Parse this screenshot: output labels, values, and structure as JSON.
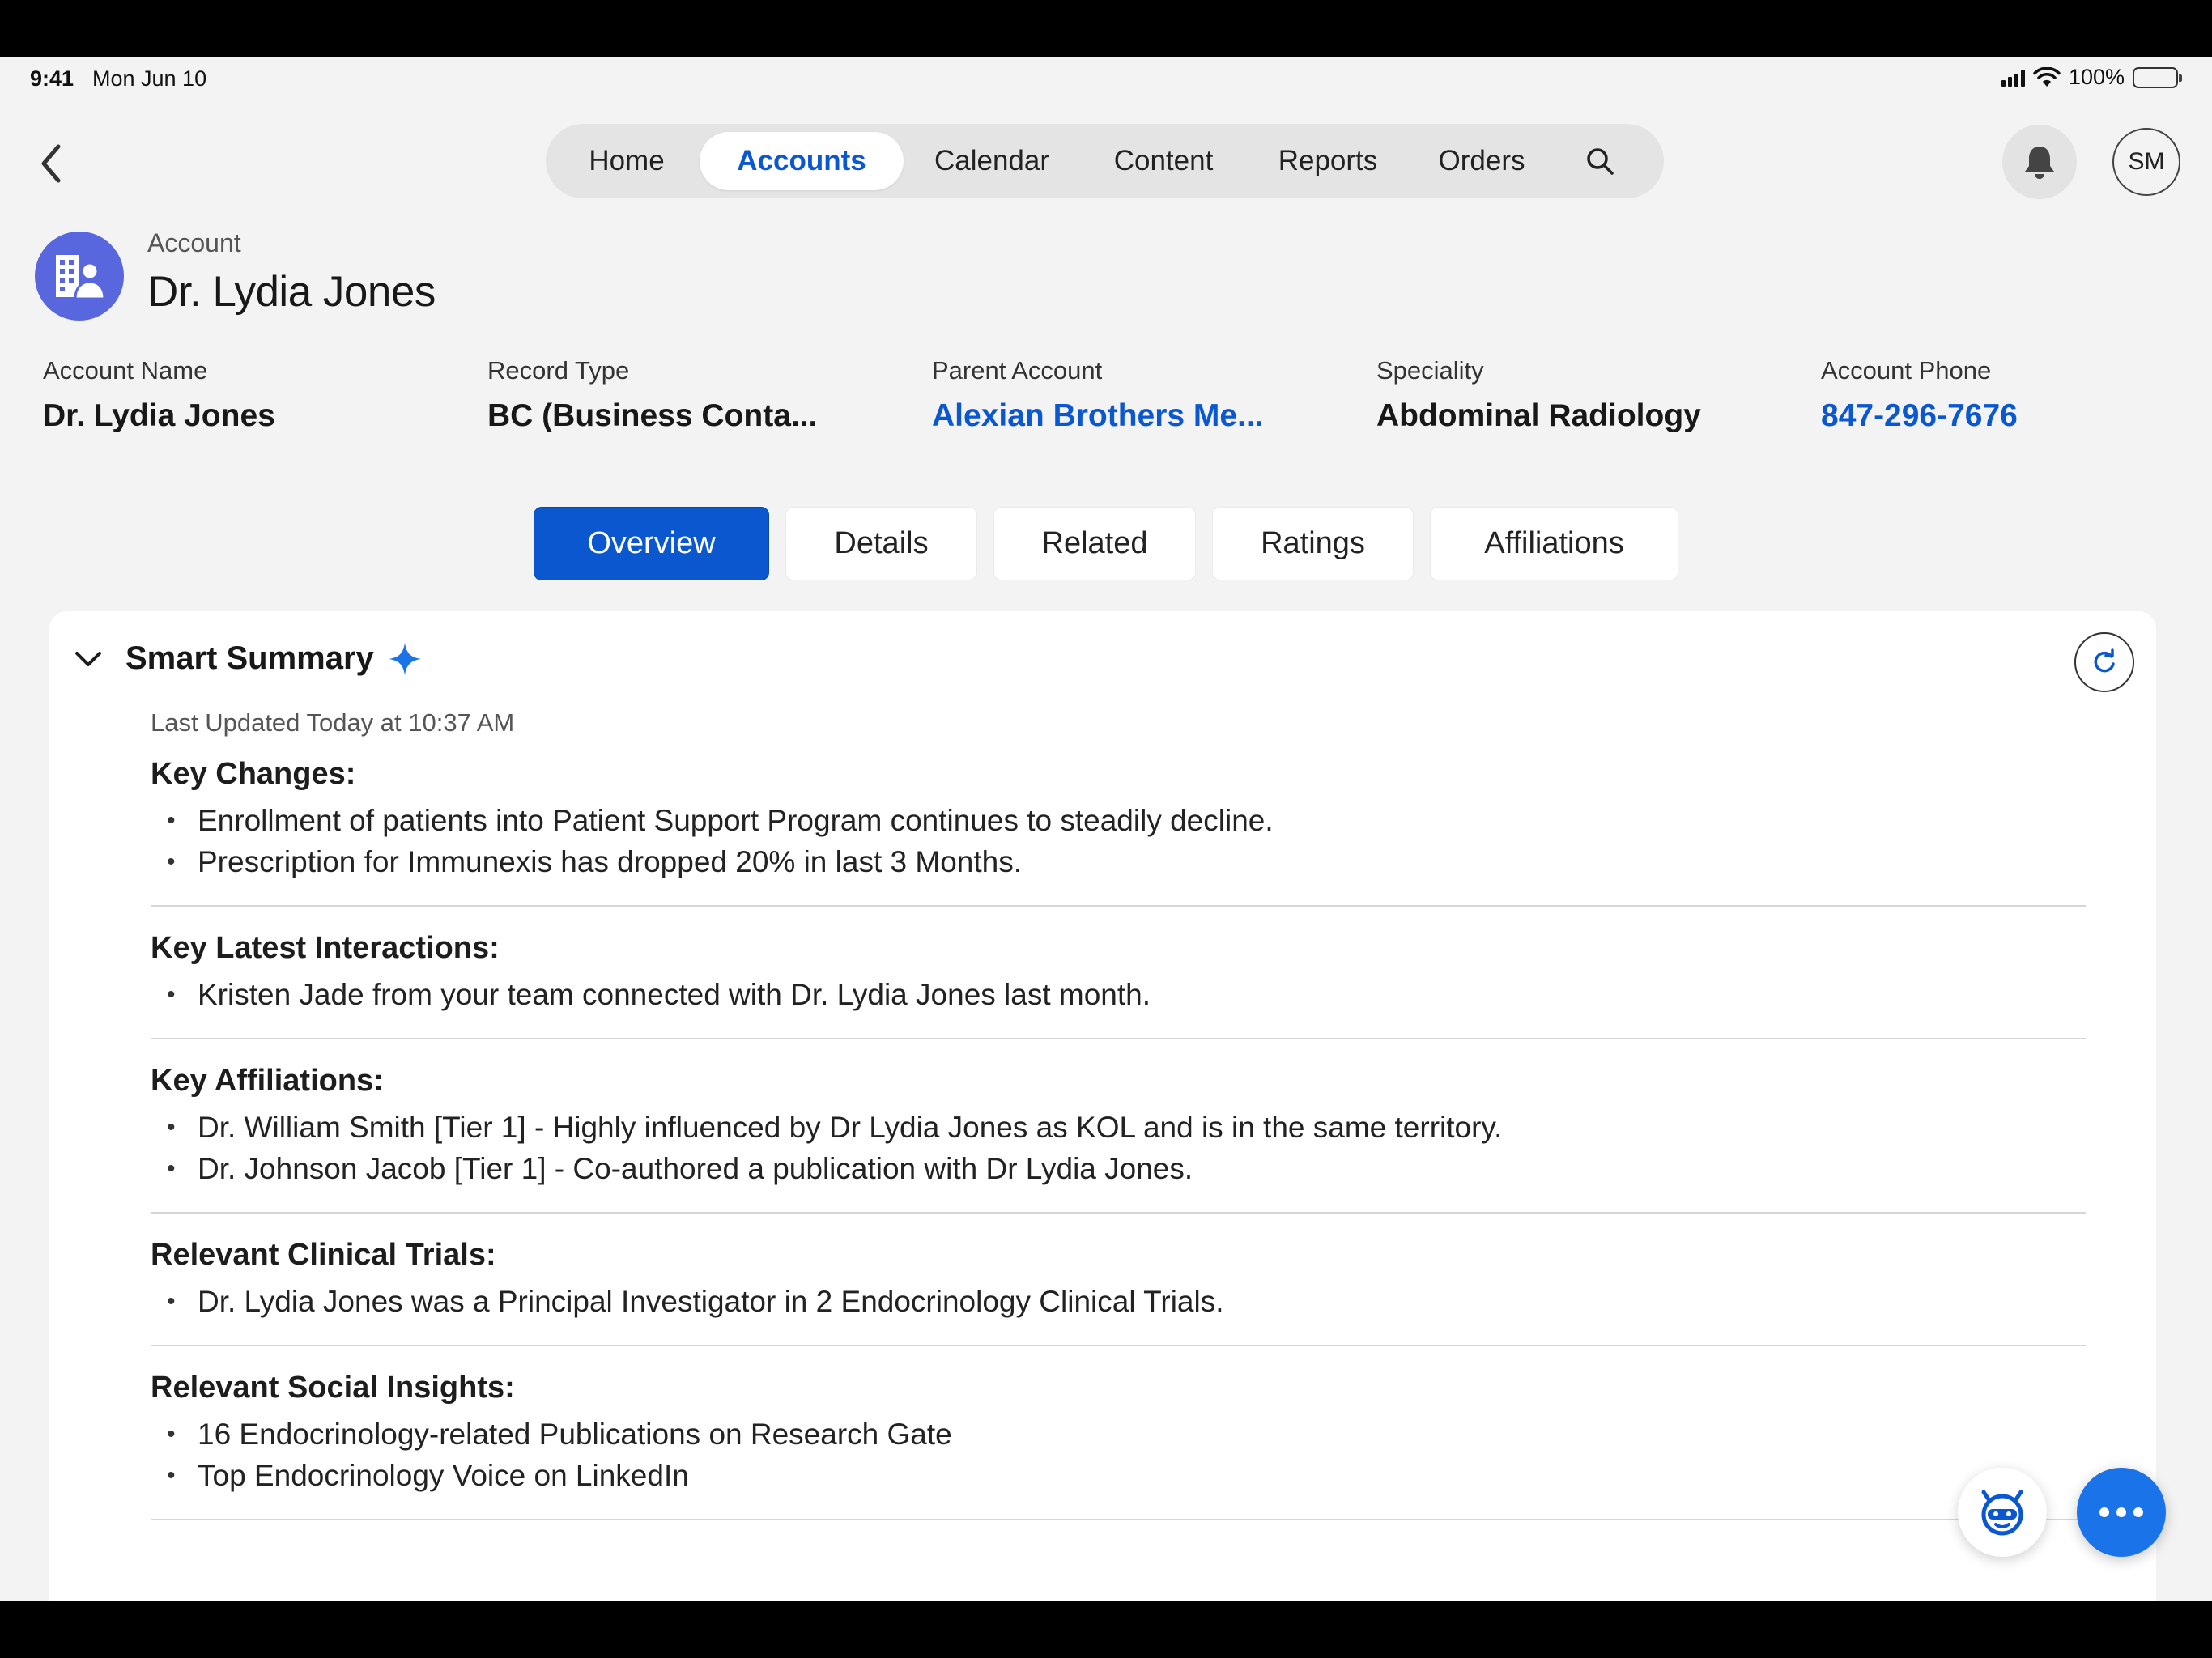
{
  "status_bar": {
    "time": "9:41",
    "date": "Mon Jun 10",
    "battery": "100%"
  },
  "nav": {
    "tabs": [
      {
        "label": "Home"
      },
      {
        "label": "Accounts"
      },
      {
        "label": "Calendar"
      },
      {
        "label": "Content"
      },
      {
        "label": "Reports"
      },
      {
        "label": "Orders"
      }
    ],
    "active_tab": "Accounts"
  },
  "user": {
    "initials": "SM"
  },
  "account": {
    "kicker": "Account",
    "title": "Dr. Lydia Jones",
    "fields": [
      {
        "label": "Account Name",
        "value": "Dr. Lydia Jones"
      },
      {
        "label": "Record Type",
        "value": "BC (Business Conta..."
      },
      {
        "label": "Parent Account",
        "value": "Alexian Brothers Me..."
      },
      {
        "label": "Speciality",
        "value": "Abdominal Radiology"
      },
      {
        "label": "Account Phone",
        "value": "847-296-7676"
      }
    ]
  },
  "tabs": [
    {
      "label": "Overview"
    },
    {
      "label": "Details"
    },
    {
      "label": "Related"
    },
    {
      "label": "Ratings"
    },
    {
      "label": "Affiliations"
    }
  ],
  "smart_summary": {
    "title": "Smart Summary",
    "updated": "Last Updated Today at 10:37 AM",
    "sections": [
      {
        "heading": "Key Changes:",
        "items": [
          "Enrollment of patients into Patient Support Program continues to steadily decline.",
          "Prescription for Immunexis has dropped 20% in last 3 Months."
        ]
      },
      {
        "heading": "Key Latest Interactions:",
        "items": [
          "Kristen Jade from your team connected with Dr. Lydia Jones last month."
        ]
      },
      {
        "heading": "Key Affiliations:",
        "items": [
          "Dr. William Smith [Tier 1] - Highly influenced by Dr Lydia Jones as KOL and is in the same territory.",
          "Dr. Johnson Jacob [Tier 1] - Co-authored a publication with Dr Lydia Jones."
        ]
      },
      {
        "heading": "Relevant Clinical Trials:",
        "items": [
          "Dr. Lydia Jones was a Principal Investigator in 2 Endocrinology Clinical Trials."
        ]
      },
      {
        "heading": "Relevant Social Insights:",
        "items": [
          "16 Endocrinology-related Publications on Research Gate",
          "Top Endocrinology Voice on LinkedIn"
        ]
      }
    ]
  },
  "colors": {
    "accent": "#0b57d0",
    "account_icon": "#5867dd",
    "fab": "#1a73e8",
    "sparkle": "#1a73e8"
  },
  "icons": [
    "chevron-left-icon",
    "search-icon",
    "bell-icon",
    "account-building-icon",
    "chevron-down-icon",
    "sparkle-icon",
    "refresh-icon",
    "assistant-bot-icon",
    "more-icon"
  ]
}
